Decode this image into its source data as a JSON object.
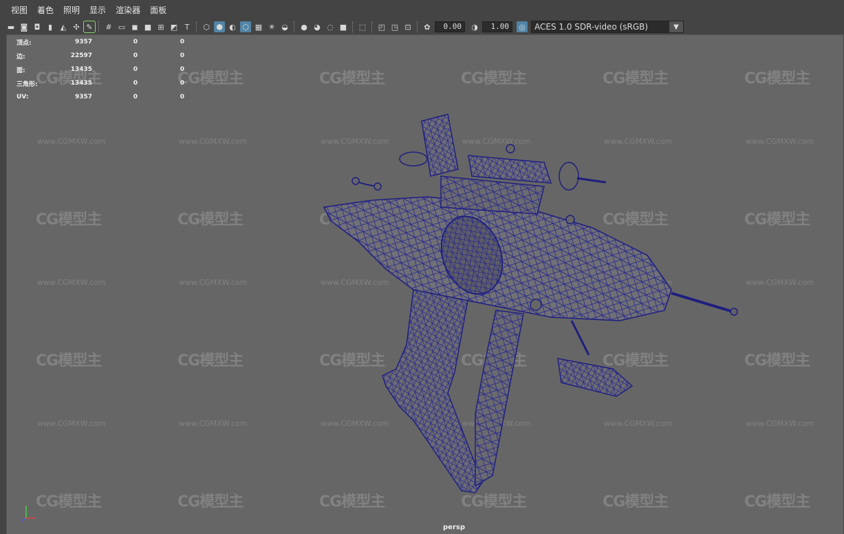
{
  "menu": [
    "视图",
    "着色",
    "照明",
    "显示",
    "渲染器",
    "面板"
  ],
  "toolbar": {
    "icons_left": [
      "camera-icon",
      "camera-attr-icon",
      "bookmark-icon",
      "image-plane-icon",
      "grid-icon",
      "film-gate-icon",
      "resolution-gate-icon",
      "gate-mask-icon",
      "field-chart-icon",
      "safe-action-icon",
      "safe-title-icon",
      "wireframe-icon",
      "smooth-shade-icon",
      "default-material-icon",
      "xray-icon",
      "textured-icon",
      "use-lights-icon",
      "shadows-icon",
      "ambient-occlusion-icon",
      "motion-blur-icon",
      "antialias-icon",
      "isolate-icon",
      "xray-joints-icon",
      "xray-active-icon",
      "backface-icon"
    ],
    "exposure": "0.00",
    "gamma": "1.00",
    "color_management": "ACES 1.0 SDR-video (sRGB)"
  },
  "hud": [
    {
      "label": "顶点:",
      "v1": "9357",
      "v2": "0",
      "v3": "0"
    },
    {
      "label": "边:",
      "v1": "22597",
      "v2": "0",
      "v3": "0"
    },
    {
      "label": "面:",
      "v1": "13435",
      "v2": "0",
      "v3": "0"
    },
    {
      "label": "三角形:",
      "v1": "13435",
      "v2": "0",
      "v3": "0"
    },
    {
      "label": "UV:",
      "v1": "9357",
      "v2": "0",
      "v3": "0"
    }
  ],
  "watermark": {
    "logo": "CG模型主",
    "url": "www.CGMXW.com"
  },
  "camera": "persp",
  "colors": {
    "viewport_bg": "#666666",
    "wire": "#2c2c8c",
    "ui_bg": "#444444",
    "accent": "#5285a6"
  }
}
